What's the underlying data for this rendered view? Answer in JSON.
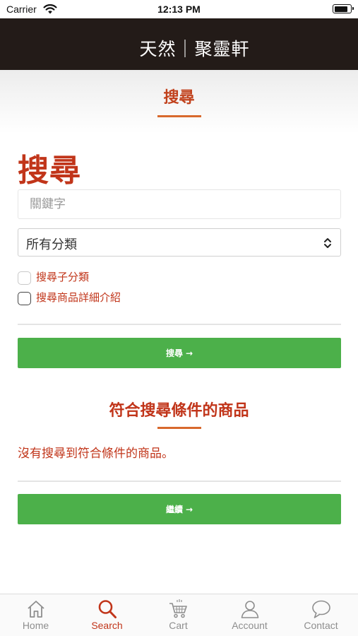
{
  "status_bar": {
    "carrier": "Carrier",
    "time": "12:13 PM",
    "battery_level": 0.9
  },
  "header": {
    "brand": "天然｜聚靈軒"
  },
  "page": {
    "title": "搜尋"
  },
  "search_form": {
    "heading": "搜尋",
    "keyword_placeholder": "關鍵字",
    "keyword_value": "",
    "category_selected": "所有分類",
    "checkbox_subcategories": {
      "label": "搜尋子分類",
      "checked": false
    },
    "checkbox_descriptions": {
      "label": "搜尋商品詳細介紹",
      "checked": false
    },
    "search_button": {
      "label": "搜尋",
      "arrow": "→"
    }
  },
  "results": {
    "title": "符合搜尋條件的商品",
    "empty_message": "沒有搜尋到符合條件的商品。",
    "continue_button": {
      "label": "繼續",
      "arrow": "→"
    }
  },
  "tab_bar": {
    "active": "search",
    "tabs": [
      {
        "id": "home",
        "label": "Home",
        "icon": "home-icon"
      },
      {
        "id": "search",
        "label": "Search",
        "icon": "search-icon"
      },
      {
        "id": "cart",
        "label": "Cart",
        "icon": "cart-icon"
      },
      {
        "id": "account",
        "label": "Account",
        "icon": "account-icon"
      },
      {
        "id": "contact",
        "label": "Contact",
        "icon": "chat-bubble-icon"
      }
    ]
  },
  "colors": {
    "header_bg": "#231b18",
    "accent_red": "#c1351a",
    "underline_orange": "#d8692d",
    "button_green": "#4cb04a",
    "tab_inactive": "#8e8e8e"
  }
}
